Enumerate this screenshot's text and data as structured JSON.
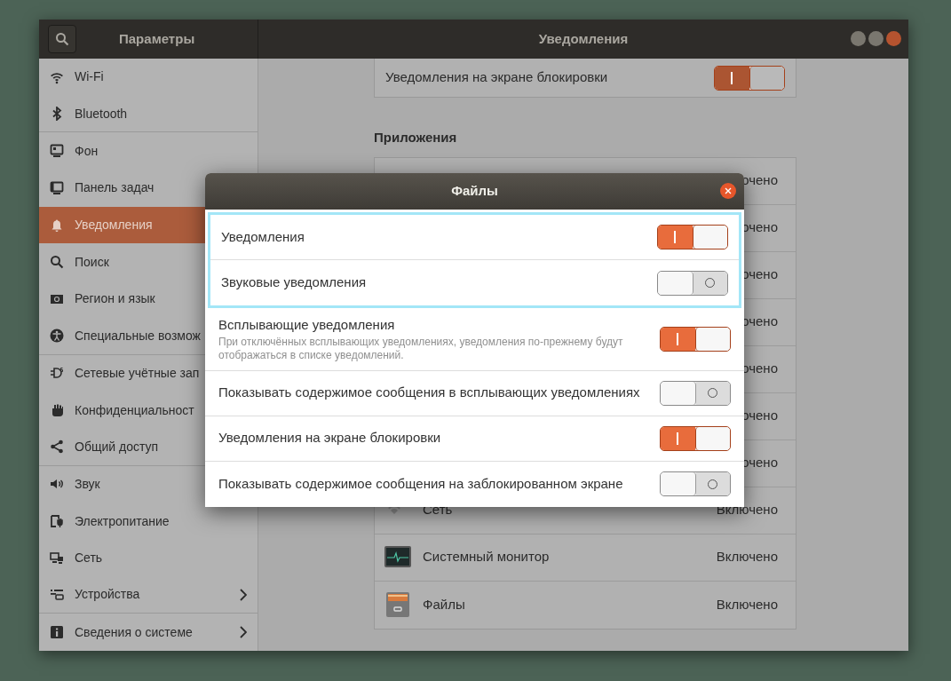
{
  "window": {
    "sidebar_title": "Параметры",
    "title": "Уведомления"
  },
  "sidebar": {
    "items": [
      {
        "label": "Wi-Fi",
        "selected": false
      },
      {
        "label": "Bluetooth",
        "selected": false
      },
      {
        "label": "Фон",
        "selected": false
      },
      {
        "label": "Панель задач",
        "selected": false
      },
      {
        "label": "Уведомления",
        "selected": true
      },
      {
        "label": "Поиск",
        "selected": false
      },
      {
        "label": "Регион и язык",
        "selected": false
      },
      {
        "label": "Специальные возмож",
        "selected": false
      },
      {
        "label": "Сетевые учётные зап",
        "selected": false
      },
      {
        "label": "Конфиденциальност",
        "selected": false
      },
      {
        "label": "Общий доступ",
        "selected": false
      },
      {
        "label": "Звук",
        "selected": false
      },
      {
        "label": "Электропитание",
        "selected": false,
        "arrow": false
      },
      {
        "label": "Сеть",
        "selected": false,
        "arrow": false
      },
      {
        "label": "Устройства",
        "selected": false,
        "arrow": true
      },
      {
        "label": "Сведения о системе",
        "selected": false,
        "arrow": true
      }
    ]
  },
  "lock_screen": {
    "label": "Уведомления на экране блокировки",
    "on": true
  },
  "apps": {
    "heading": "Приложения",
    "rows": [
      {
        "status": "очено"
      },
      {
        "status": "очено"
      },
      {
        "status": "очено"
      },
      {
        "status": "очено"
      },
      {
        "status": "очено"
      },
      {
        "status": "очено"
      },
      {
        "status": "очено"
      },
      {
        "name": "Сеть",
        "status": "Включено"
      },
      {
        "name": "Системный монитор",
        "status": "Включено"
      },
      {
        "name": "Файлы",
        "status": "Включено"
      }
    ]
  },
  "dialog": {
    "title": "Файлы",
    "rows": [
      {
        "label": "Уведомления",
        "on": true,
        "highlighted": true
      },
      {
        "label": "Звуковые уведомления",
        "on": false,
        "highlighted": true
      },
      {
        "label": "Всплывающие уведомления",
        "description": "При отключённых всплывающих уведомлениях, уведомления по-прежнему будут отображаться в списке уведомлений.",
        "on": true,
        "highlighted": false
      },
      {
        "label": "Показывать содержимое сообщения в всплывающих уведомлениях",
        "on": false,
        "highlighted": false
      },
      {
        "label": "Уведомления на экране блокировки",
        "on": true,
        "highlighted": false
      },
      {
        "label": "Показывать содержимое сообщения на заблокированном экране",
        "on": false,
        "highlighted": false
      }
    ]
  }
}
